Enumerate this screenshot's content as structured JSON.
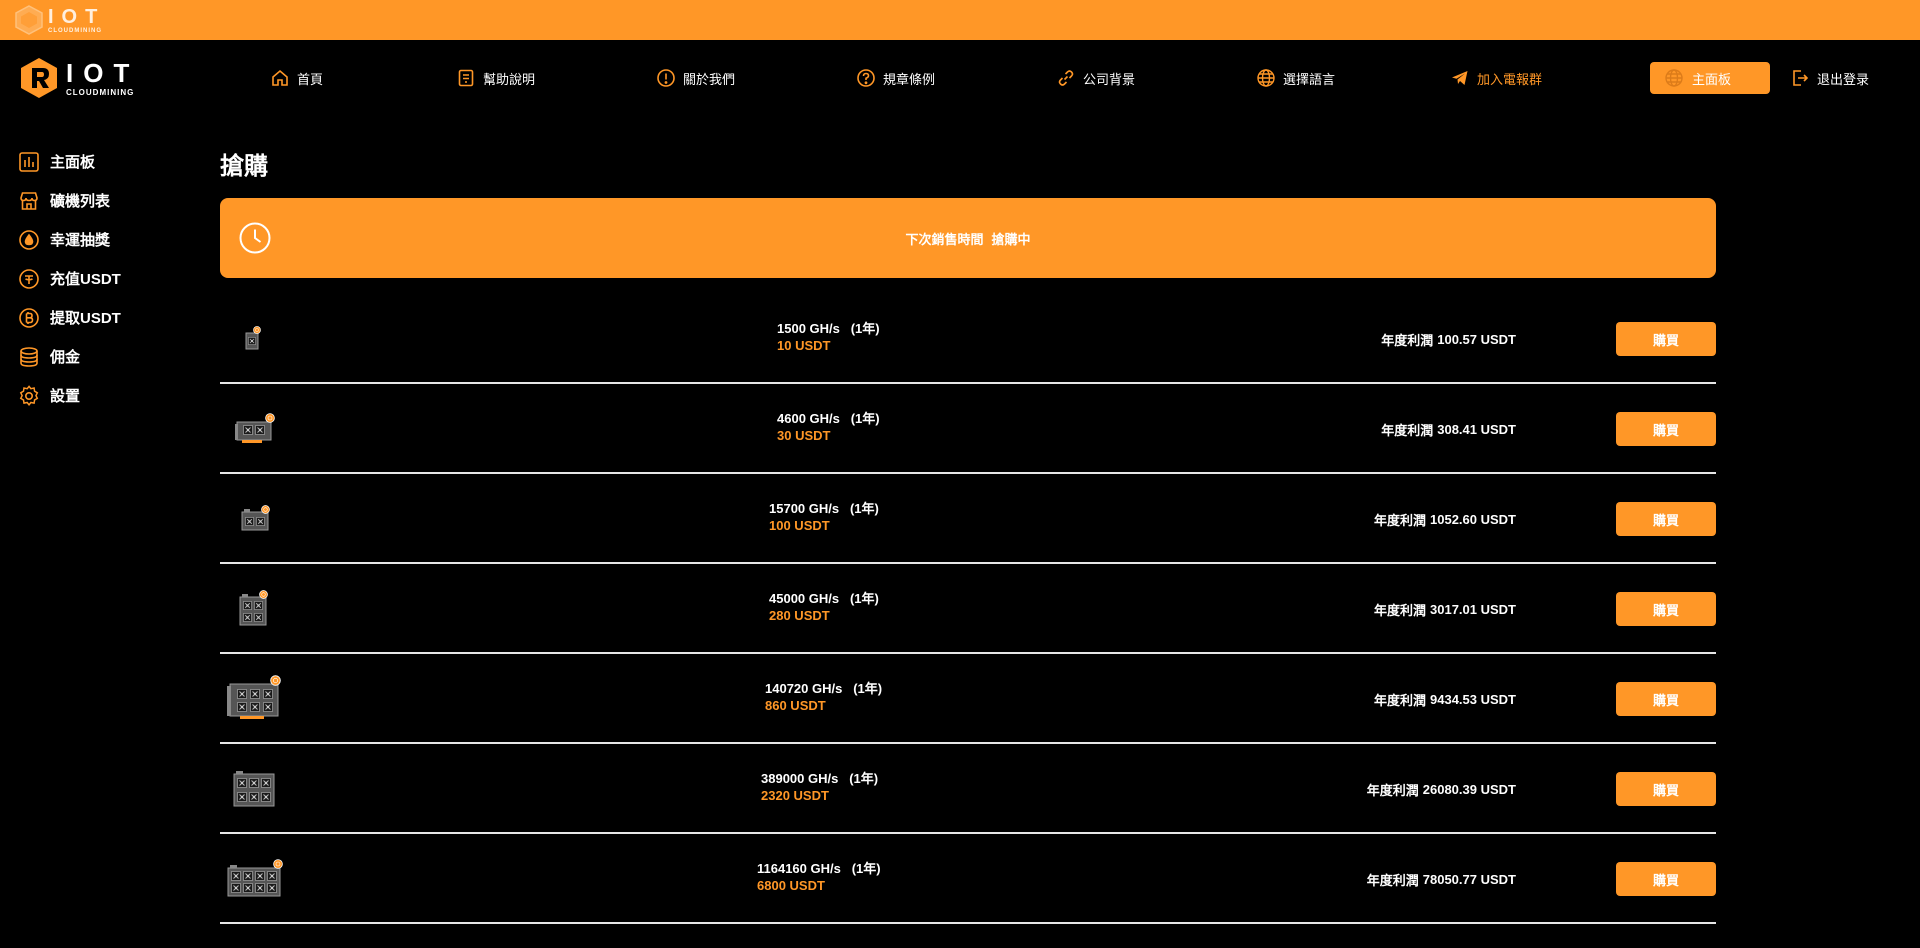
{
  "colors": {
    "accent": "#ff9727",
    "background": "#000000",
    "divider": "#e6e6e6"
  },
  "logo": {
    "big": "IOT",
    "small": "CLOUDMINING"
  },
  "brand": {
    "big": "IOT",
    "small": "CLOUDMINING"
  },
  "nav": {
    "items": [
      {
        "label": "首頁",
        "icon": "home-icon"
      },
      {
        "label": "幫助說明",
        "icon": "help-doc-icon"
      },
      {
        "label": "關於我們",
        "icon": "info-icon"
      },
      {
        "label": "規章條例",
        "icon": "question-icon"
      },
      {
        "label": "公司背景",
        "icon": "link-icon"
      },
      {
        "label": "選擇語言",
        "icon": "globe-icon"
      },
      {
        "label": "加入電報群",
        "icon": "telegram-icon"
      }
    ],
    "dashboard": {
      "label": "主面板",
      "icon": "globe-icon"
    },
    "logout": {
      "label": "退出登录",
      "icon": "logout-icon"
    }
  },
  "sidebar": {
    "items": [
      {
        "label": "主面板",
        "icon": "bar-chart-icon"
      },
      {
        "label": "礦機列表",
        "icon": "store-icon"
      },
      {
        "label": "幸運抽獎",
        "icon": "drop-icon"
      },
      {
        "label": "充值USDT",
        "icon": "coin-deposit-icon"
      },
      {
        "label": "提取USDT",
        "icon": "bitcoin-icon"
      },
      {
        "label": "佣金",
        "icon": "database-icon"
      },
      {
        "label": "設置",
        "icon": "gear-icon"
      }
    ]
  },
  "page": {
    "title": "搶購"
  },
  "banner": {
    "label": "下次銷售時間",
    "status": "搶購中"
  },
  "products": [
    {
      "hashrate": "1500 GH/s",
      "term": "(1年)",
      "price": "10 USDT",
      "profit_label": "年度利潤",
      "profit": "100.57 USDT",
      "buy_label": "購買",
      "miner_icon": "miner-small-icon"
    },
    {
      "hashrate": "4600 GH/s",
      "term": "(1年)",
      "price": "30 USDT",
      "profit_label": "年度利潤",
      "profit": "308.41 USDT",
      "buy_label": "購買",
      "miner_icon": "gpu-card-icon"
    },
    {
      "hashrate": "15700 GH/s",
      "term": "(1年)",
      "price": "100 USDT",
      "profit_label": "年度利潤",
      "profit": "1052.60 USDT",
      "buy_label": "購買",
      "miner_icon": "miner-2fan-icon"
    },
    {
      "hashrate": "45000 GH/s",
      "term": "(1年)",
      "price": "280 USDT",
      "profit_label": "年度利潤",
      "profit": "3017.01 USDT",
      "buy_label": "購買",
      "miner_icon": "miner-4fan-icon"
    },
    {
      "hashrate": "140720 GH/s",
      "term": "(1年)",
      "price": "860 USDT",
      "profit_label": "年度利潤",
      "profit": "9434.53 USDT",
      "buy_label": "購買",
      "miner_icon": "gpu-rig-icon"
    },
    {
      "hashrate": "389000 GH/s",
      "term": "(1年)",
      "price": "2320 USDT",
      "profit_label": "年度利潤",
      "profit": "26080.39 USDT",
      "buy_label": "購買",
      "miner_icon": "miner-6fan-icon"
    },
    {
      "hashrate": "1164160 GH/s",
      "term": "(1年)",
      "price": "6800 USDT",
      "profit_label": "年度利潤",
      "profit": "78050.77 USDT",
      "buy_label": "購買",
      "miner_icon": "miner-8fan-icon"
    }
  ]
}
